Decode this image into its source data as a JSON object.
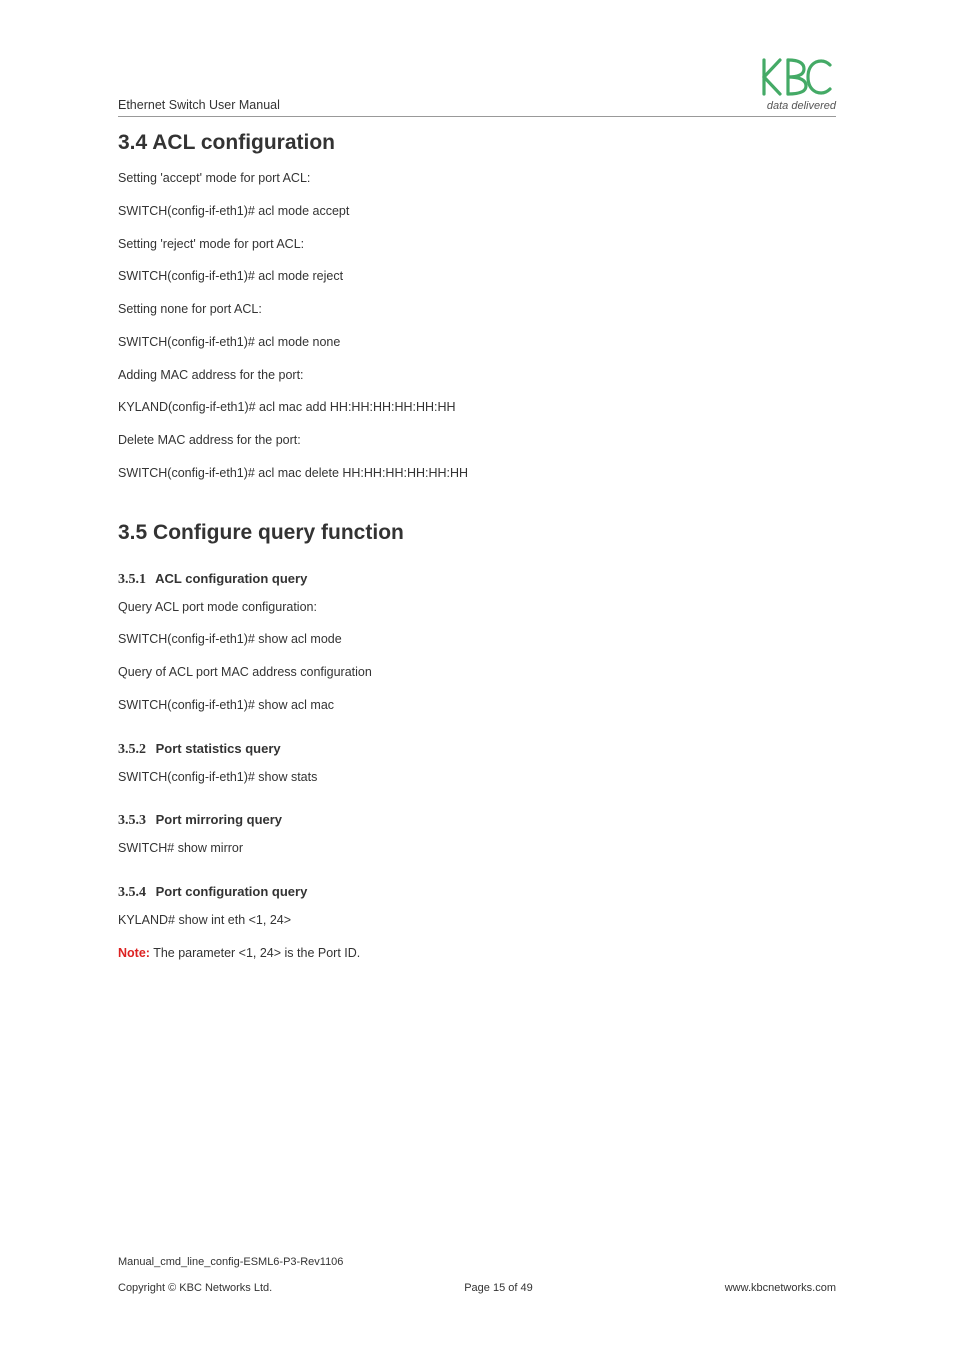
{
  "header": {
    "title": "Ethernet Switch User Manual",
    "tagline": "data delivered"
  },
  "s34": {
    "heading": "3.4 ACL configuration",
    "p1": "Setting 'accept' mode for port ACL:",
    "p2": "SWITCH(config-if-eth1)# acl mode accept",
    "p3": "Setting 'reject' mode for port ACL:",
    "p4": "SWITCH(config-if-eth1)# acl mode reject",
    "p5": "Setting none for port ACL:",
    "p6": "SWITCH(config-if-eth1)# acl mode none",
    "p7": "Adding MAC address for  the port:",
    "p8": "KYLAND(config-if-eth1)# acl mac add HH:HH:HH:HH:HH:HH",
    "p9": "Delete MAC address for the port:",
    "p10": "SWITCH(config-if-eth1)# acl mac delete HH:HH:HH:HH:HH:HH"
  },
  "s35": {
    "heading": "3.5 Configure query function",
    "sub1_num": "3.5.1",
    "sub1_title": "ACL configuration query",
    "sub1_p1": "Query ACL port mode configuration:",
    "sub1_p2": "SWITCH(config-if-eth1)# show acl mode",
    "sub1_p3": "Query of ACL port MAC address configuration",
    "sub1_p4": "SWITCH(config-if-eth1)# show acl mac",
    "sub2_num": "3.5.2",
    "sub2_title": "Port statistics query",
    "sub2_p1": "SWITCH(config-if-eth1)# show stats",
    "sub3_num": "3.5.3",
    "sub3_title": "Port mirroring query",
    "sub3_p1": "SWITCH# show mirror",
    "sub4_num": "3.5.4",
    "sub4_title": "Port configuration query",
    "sub4_p1": "KYLAND# show int eth <1, 24>",
    "sub4_note_label": "Note:",
    "sub4_note_text": " The parameter <1, 24> is the Port ID."
  },
  "footer": {
    "file": "Manual_cmd_line_config-ESML6-P3-Rev1106",
    "copyright": "Copyright © KBC Networks Ltd.",
    "page": "Page 15 of 49",
    "url": "www.kbcnetworks.com"
  }
}
